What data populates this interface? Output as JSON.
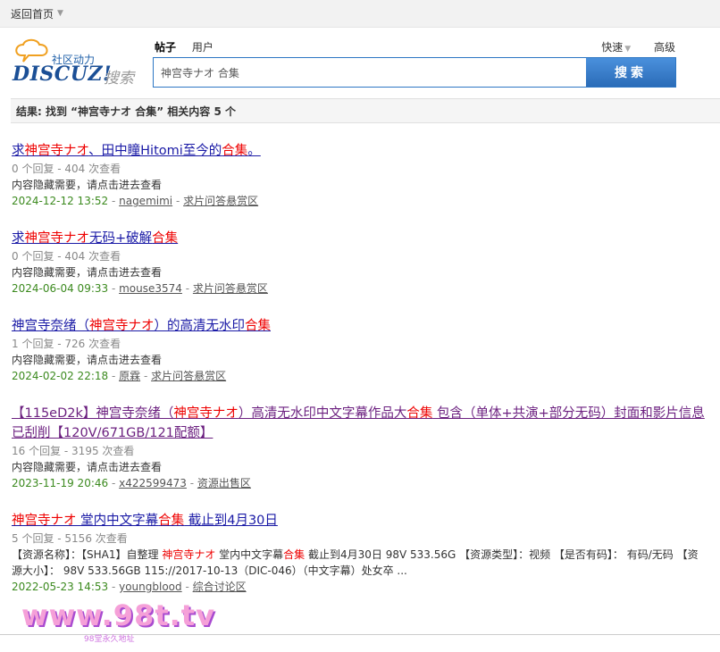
{
  "topbar": {
    "home_label": "返回首页"
  },
  "logo": {
    "slogan": "社区动力",
    "brand": "DISCUZ!",
    "search_word": "搜索"
  },
  "search": {
    "types": [
      "帖子",
      "用户"
    ],
    "quick_label": "快速",
    "advanced_label": "高级",
    "query": "神宫寺ナオ 合集",
    "button_label": "搜索"
  },
  "result_summary": "结果: 找到 “神宫寺ナオ 合集” 相关内容 5 个",
  "results": [
    {
      "title": [
        "求",
        "神宫寺ナオ",
        "、田中瞳Hitomi至今的",
        "合集",
        "。"
      ],
      "meta": "0 个回复 - 404 次查看",
      "desc": "内容隐藏需要，请点击进去查看",
      "date": "2024-12-12 13:52",
      "author": "nagemimi",
      "forum": "求片问答悬赏区"
    },
    {
      "title": [
        "求",
        "神宫寺ナオ",
        "无码+破解",
        "合集",
        ""
      ],
      "meta": "0 个回复 - 404 次查看",
      "desc": "内容隐藏需要，请点击进去查看",
      "date": "2024-06-04 09:33",
      "author": "mouse3574",
      "forum": "求片问答悬赏区"
    },
    {
      "title": [
        "神宫寺奈绪（",
        "神宫寺ナオ",
        "）的高清无水印",
        "合集",
        ""
      ],
      "meta": "1 个回复 - 726 次查看",
      "desc": "内容隐藏需要，请点击进去查看",
      "date": "2024-02-02 22:18",
      "author": "原霖",
      "forum": "求片问答悬赏区"
    },
    {
      "title": [
        "【115eD2k】神宫寺奈绪（",
        "神宫寺ナオ",
        "）高清无水印中文字幕作品大",
        "合集",
        " 包含（单体+共演+部分无码）封面和影片信息已刮削【120V/671GB/121配额】"
      ],
      "meta": "16 个回复 - 3195 次查看",
      "desc": "内容隐藏需要，请点击进去查看",
      "date": "2023-11-19 20:46",
      "author": "x422599473",
      "forum": "资源出售区"
    },
    {
      "title": [
        "",
        "神宫寺ナオ",
        " 堂内中文字幕",
        "合集",
        " 截止到4月30日"
      ],
      "meta": "5 个回复 - 5156 次查看",
      "desc_parts": [
        "【资源名称】：【SHA1】自整理 ",
        "神宫寺ナオ",
        " 堂内中文字幕",
        "合集",
        " 截止到4月30日 98V 533.56G 【资源类型】：视频 【是否有码】： 有码/无码 【资源大小】： 98V 533.56GB 115://2017-10-13（DIC-046）（中文字幕）处女卒 ..."
      ],
      "date": "2022-05-23 14:53",
      "author": "youngblood",
      "forum": "综合讨论区"
    }
  ],
  "watermark": {
    "text": "www.98t.tv",
    "sub": "98堂永久地址"
  }
}
